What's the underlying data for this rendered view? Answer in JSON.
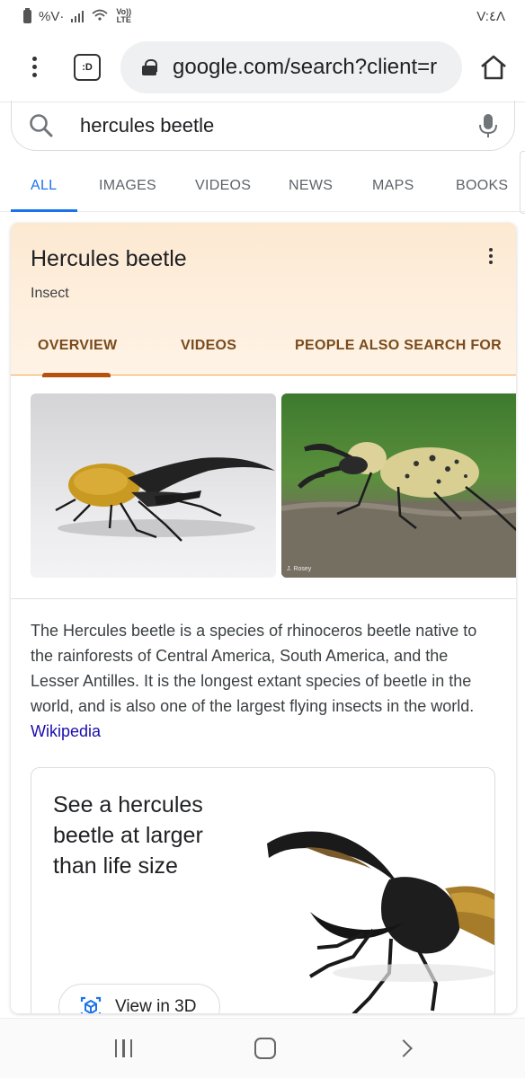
{
  "status_bar": {
    "battery_text": "%V·",
    "volte_line1": "Vo))",
    "volte_line2": "LTE",
    "time": "V:٤Λ"
  },
  "toolbar": {
    "tab_switcher_label": ":D",
    "url": "google.com/search?client=r"
  },
  "search": {
    "query": "hercules beetle"
  },
  "tabs": [
    {
      "label": "ALL",
      "active": true
    },
    {
      "label": "IMAGES",
      "active": false
    },
    {
      "label": "VIDEOS",
      "active": false
    },
    {
      "label": "NEWS",
      "active": false
    },
    {
      "label": "MAPS",
      "active": false
    },
    {
      "label": "BOOKS",
      "active": false
    }
  ],
  "knowledge_panel": {
    "title": "Hercules beetle",
    "subtitle": "Insect",
    "tabs": [
      {
        "label": "OVERVIEW",
        "active": true
      },
      {
        "label": "VIDEOS",
        "active": false
      },
      {
        "label": "PEOPLE ALSO SEARCH FOR",
        "active": false
      }
    ],
    "image_credit": "J. Rosey",
    "description": "The Hercules beetle is a species of rhinoceros beetle native to the rainforests of Central America, South America, and the Lesser Antilles. It is the longest extant species of beetle in the world, and is also one of the largest flying insects in the world.",
    "source_link": "Wikipedia",
    "card_3d": {
      "title": "See a hercules beetle at larger than life size",
      "button_label": "View in 3D"
    }
  },
  "colors": {
    "accent": "#1a73e8",
    "panel_header": "#fde9d2",
    "panel_tab_text": "#7a4b1c",
    "panel_tab_indicator": "#b5520b",
    "link": "#1a0dab"
  }
}
